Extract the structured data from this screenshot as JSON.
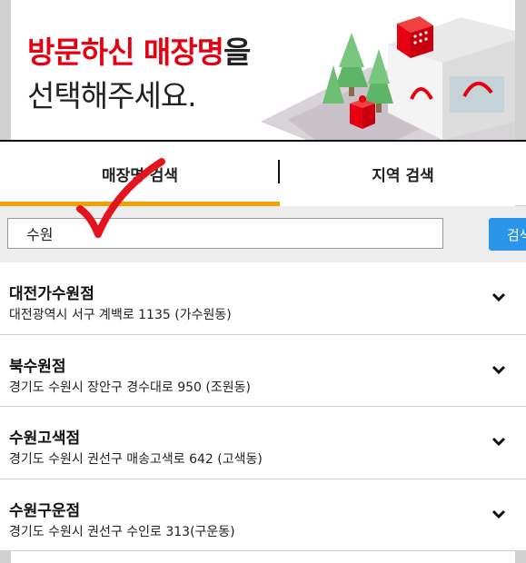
{
  "banner": {
    "title_red": "방문하신 매장명",
    "title_suffix": "을",
    "title_line2": "선택해주세요."
  },
  "tabs": [
    {
      "label": "매장명 검색",
      "active": true
    },
    {
      "label": "지역 검색",
      "active": false
    }
  ],
  "search": {
    "value": "수원",
    "button_label": "검색"
  },
  "stores": [
    {
      "name": "대전가수원점",
      "address": "대전광역시 서구 계백로 1135 (가수원동)"
    },
    {
      "name": "북수원점",
      "address": "경기도 수원시 장안구 경수대로 950 (조원동)"
    },
    {
      "name": "수원고색점",
      "address": "경기도 수원시 권선구 매송고색로 642 (고색동)"
    },
    {
      "name": "수원구운점",
      "address": "경기도 수원시 권선구 수인로 313(구운동)"
    }
  ],
  "colors": {
    "brand_red": "#e60012",
    "tab_accent": "#f0a000",
    "button_blue": "#2b95e9"
  }
}
